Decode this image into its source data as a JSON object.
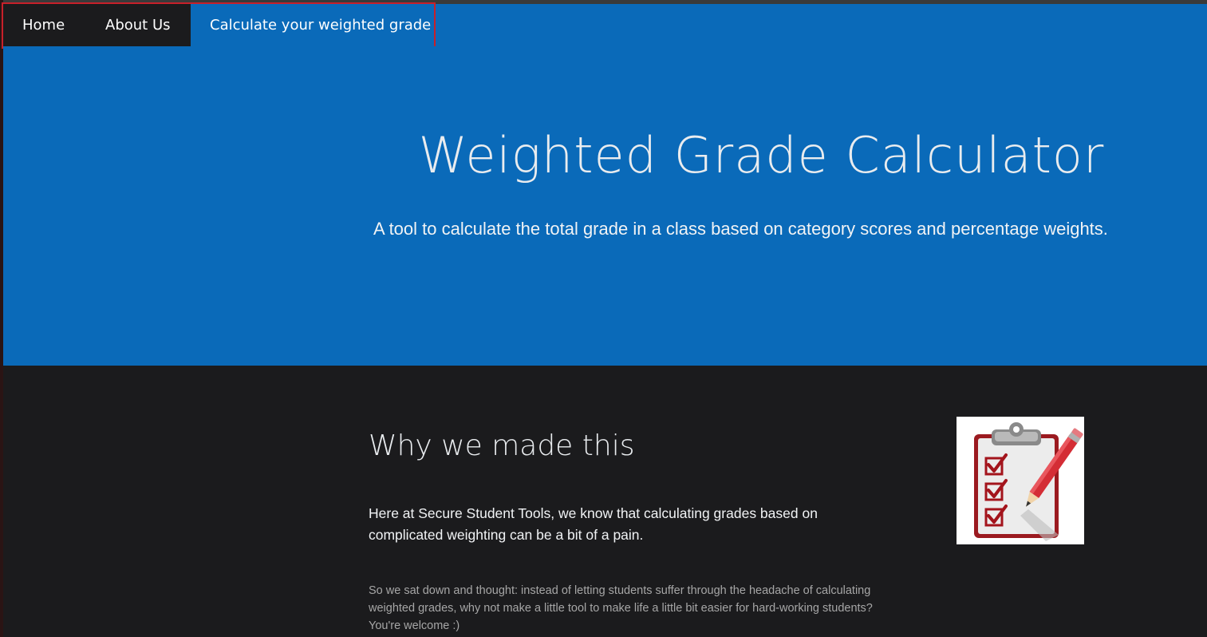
{
  "nav": {
    "items": [
      {
        "label": "Home"
      },
      {
        "label": "About Us"
      },
      {
        "label": "Calculate your weighted grade"
      }
    ]
  },
  "hero": {
    "title": "Weighted Grade Calculator",
    "subtitle": "A tool to calculate the total grade in a class based on category scores and percentage weights."
  },
  "about": {
    "title": "Why we made this",
    "paragraph_1": "Here at Secure Student Tools, we know that calculating grades based on complicated weighting can be a bit of a pain.",
    "paragraph_2": "So we sat down and thought: instead of letting students suffer through the headache of calculating weighted grades, why not make a little tool to make life a little bit easier for hard-working students? You're welcome :)",
    "image_icon": "clipboard-checklist-pencil-icon"
  },
  "colors": {
    "brand_blue": "#0a6ab9",
    "dark_bg": "#1b1b1d",
    "highlight_border": "#c8202a",
    "check_red": "#a3141c"
  }
}
